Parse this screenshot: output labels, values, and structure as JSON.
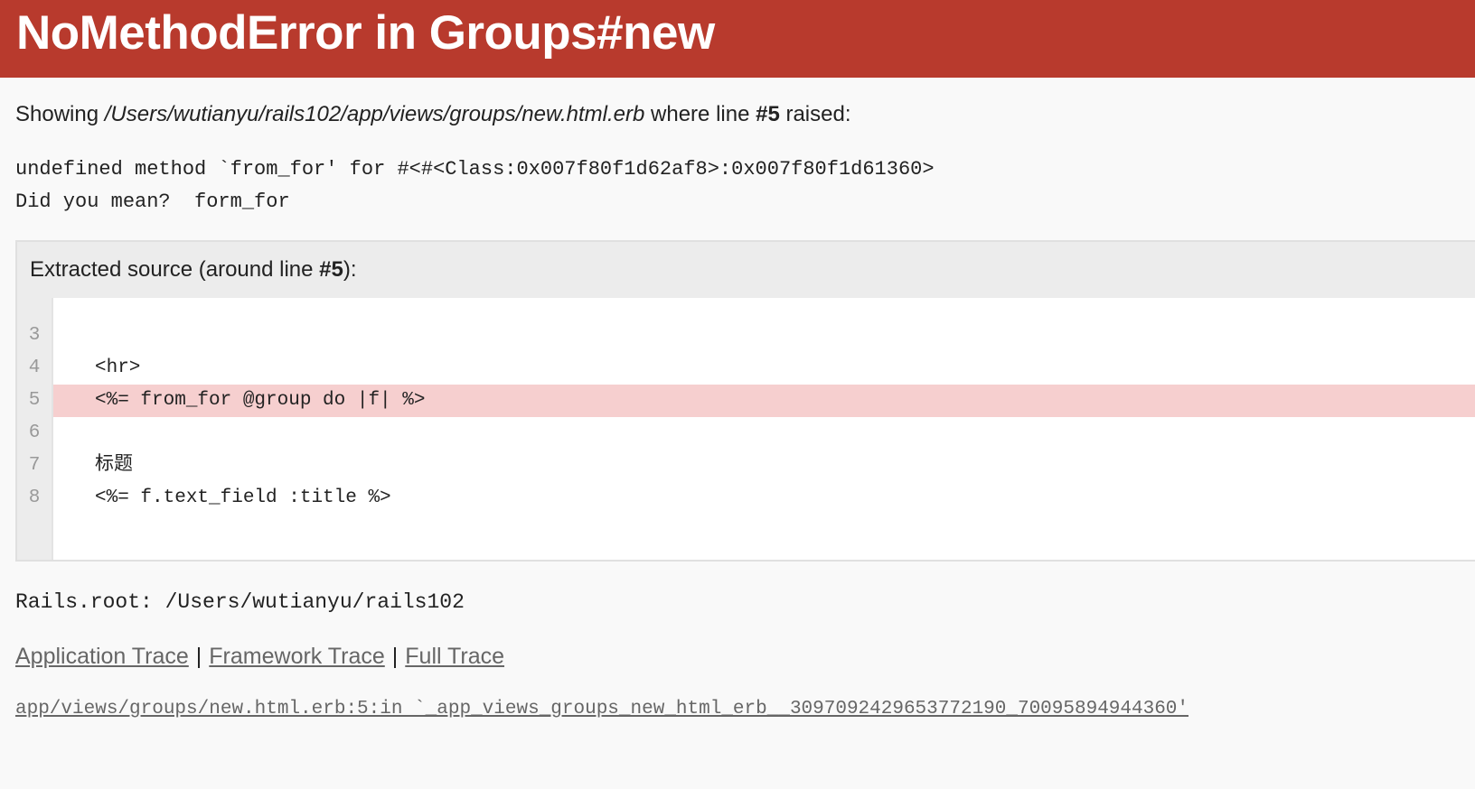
{
  "header": {
    "title": "NoMethodError in Groups#new"
  },
  "showing": {
    "prefix": "Showing ",
    "path": "/Users/wutianyu/rails102/app/views/groups/new.html.erb",
    "middle": " where line ",
    "line_ref": "#5",
    "suffix": " raised:"
  },
  "message": {
    "line1": "undefined method `from_for' for #<#<Class:0x007f80f1d62af8>:0x007f80f1d61360>",
    "line2": "Did you mean?  form_for"
  },
  "source": {
    "title_prefix": "Extracted source (around line ",
    "title_line": "#5",
    "title_suffix": "):",
    "lines": [
      {
        "number": "3",
        "code": ""
      },
      {
        "number": "4",
        "code": "<hr>"
      },
      {
        "number": "5",
        "code": "<%= from_for @group do |f| %>"
      },
      {
        "number": "6",
        "code": ""
      },
      {
        "number": "7",
        "code": "标题"
      },
      {
        "number": "8",
        "code": "<%= f.text_field :title %>"
      }
    ],
    "highlighted_line": "5"
  },
  "rails_root": "Rails.root: /Users/wutianyu/rails102",
  "traces": {
    "application": "Application Trace",
    "framework": "Framework Trace",
    "full": "Full Trace",
    "separator": "|"
  },
  "trace_entries": [
    "app/views/groups/new.html.erb:5:in `_app_views_groups_new_html_erb__3097092429653772190_70095894944360'"
  ],
  "colors": {
    "header_bg": "#b83a2d",
    "highlight_bg": "#f6cfcf",
    "page_bg": "#f9f9f9"
  }
}
